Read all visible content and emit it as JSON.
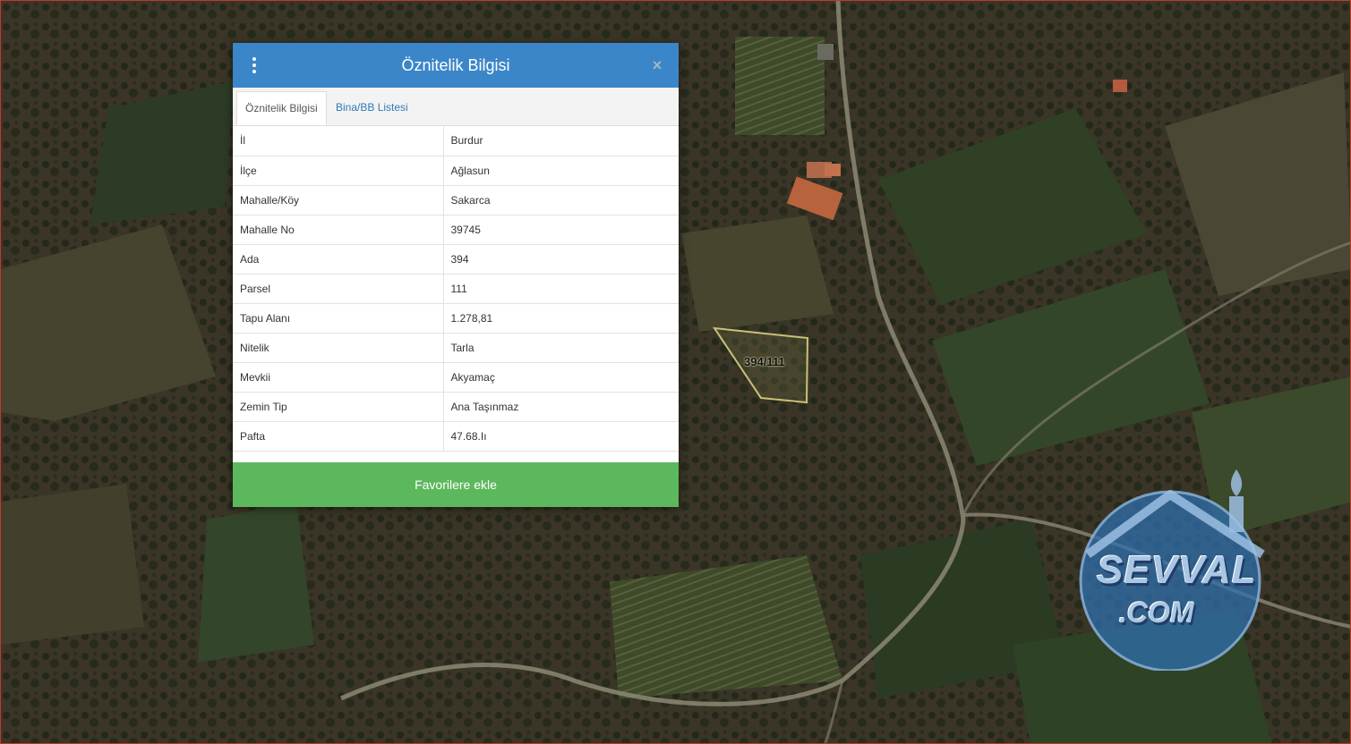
{
  "dialog": {
    "title": "Öznitelik Bilgisi",
    "menu_icon": "vertical-dots-icon",
    "close_icon": "close-icon",
    "close_symbol": "×",
    "tabs": [
      {
        "label": "Öznitelik Bilgisi",
        "active": true
      },
      {
        "label": "Bina/BB Listesi",
        "active": false
      }
    ],
    "rows": [
      {
        "key": "İl",
        "value": "Burdur"
      },
      {
        "key": "İlçe",
        "value": "Ağlasun"
      },
      {
        "key": "Mahalle/Köy",
        "value": "Sakarca"
      },
      {
        "key": "Mahalle No",
        "value": "39745"
      },
      {
        "key": "Ada",
        "value": "394"
      },
      {
        "key": "Parsel",
        "value": "111"
      },
      {
        "key": "Tapu Alanı",
        "value": "1.278,81"
      },
      {
        "key": "Nitelik",
        "value": "Tarla"
      },
      {
        "key": "Mevkii",
        "value": "Akyamaç"
      },
      {
        "key": "Zemin Tip",
        "value": "Ana Taşınmaz"
      },
      {
        "key": "Pafta",
        "value": "47.68.Iı"
      }
    ],
    "favorite_button": "Favorilere ekle",
    "colors": {
      "header": "#3b86c8",
      "button": "#5cb85c"
    }
  },
  "map": {
    "parcel_label": "394/111",
    "parcel_outline_color": "#c8c27a"
  },
  "watermark": {
    "line1": "SEVVAL",
    "line2": ".COM"
  }
}
